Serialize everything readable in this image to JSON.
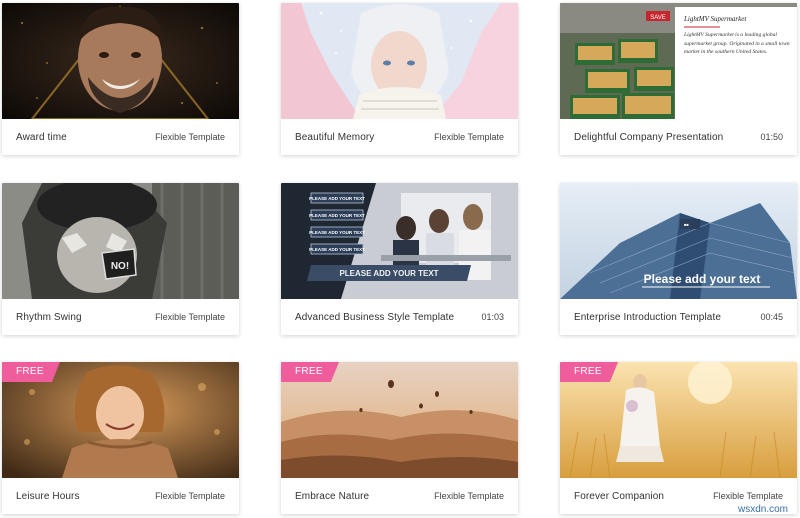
{
  "cards": [
    {
      "title": "Award time",
      "meta": "Flexible Template",
      "free": ""
    },
    {
      "title": "Beautiful Memory",
      "meta": "Flexible Template",
      "free": ""
    },
    {
      "title": "Delightful Company Presentation",
      "meta": "01:50",
      "free": ""
    },
    {
      "title": "Rhythm Swing",
      "meta": "Flexible Template",
      "free": ""
    },
    {
      "title": "Advanced Business Style Template",
      "meta": "01:03",
      "free": ""
    },
    {
      "title": "Enterprise Introduction Template",
      "meta": "00:45",
      "free": ""
    },
    {
      "title": "Leisure Hours",
      "meta": "Flexible Template",
      "free": "FREE"
    },
    {
      "title": "Embrace Nature",
      "meta": "Flexible Template",
      "free": "FREE"
    },
    {
      "title": "Forever Companion",
      "meta": "Flexible Template",
      "free": "FREE"
    }
  ],
  "overlays": {
    "supermarket_title": "LightMV Supermarket",
    "supermarket_text": "LightMV Supermarket is a leading global supermarket group. Originated in a small town market in the southern United States.",
    "save_sign": "SAVE",
    "no_sign": "NO!",
    "business_boxes": [
      "PLEASE ADD YOUR TEXT",
      "PLEASE ADD YOUR TEXT",
      "PLEASE ADD YOUR TEXT",
      "PLEASE ADD YOUR TEXT"
    ],
    "business_banner": "PLEASE ADD YOUR TEXT",
    "enterprise_text": "Please add your text"
  },
  "watermark": "wsxdn.com",
  "colors": {
    "free_badge": "#ef5d9c",
    "card_bg": "#ffffff"
  }
}
